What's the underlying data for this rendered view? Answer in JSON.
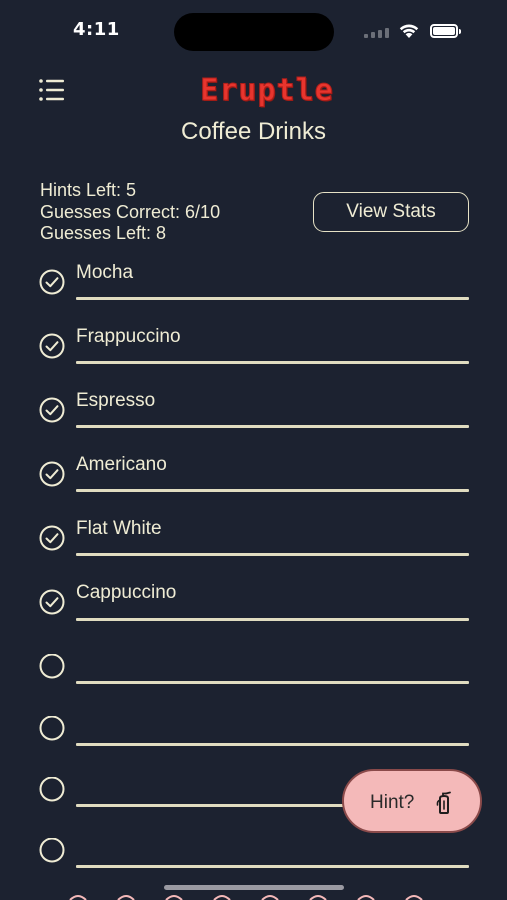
{
  "status_bar": {
    "time": "4:11",
    "icons": [
      "cellular-signal-icon",
      "wifi-icon",
      "battery-icon"
    ]
  },
  "header": {
    "menu_icon": "hamburger-menu-icon",
    "logo_text": "Eruptle",
    "title": "Coffee Drinks"
  },
  "stats": {
    "hints_left": "Hints Left: 5",
    "guesses_correct": "Guesses Correct: 6/10",
    "guesses_left": "Guesses Left: 8",
    "view_stats_label": "View Stats"
  },
  "guesses": [
    {
      "text": "Mocha",
      "correct": true
    },
    {
      "text": "Frappuccino",
      "correct": true
    },
    {
      "text": "Espresso",
      "correct": true
    },
    {
      "text": "Americano",
      "correct": true
    },
    {
      "text": "Flat White",
      "correct": true
    },
    {
      "text": "Cappuccino",
      "correct": true
    },
    {
      "text": "",
      "correct": false
    },
    {
      "text": "",
      "correct": false
    },
    {
      "text": "",
      "correct": false
    },
    {
      "text": "",
      "correct": false
    }
  ],
  "hint_button": {
    "label": "Hint?",
    "icon": "fire-extinguisher-icon"
  },
  "colors": {
    "background": "#1c2230",
    "text": "#efecd4",
    "logo": "#e8352e",
    "hint_button": "#f4b9b9"
  }
}
